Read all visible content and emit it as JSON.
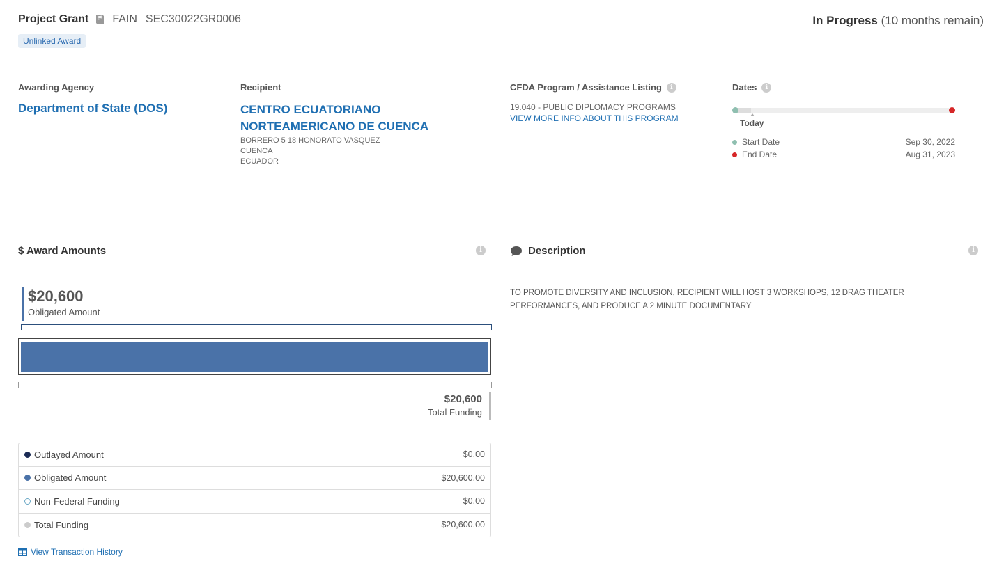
{
  "header": {
    "award_type": "Project Grant",
    "fain_label": "FAIN",
    "fain_value": "SEC30022GR0006",
    "badge": "Unlinked Award",
    "status_bold": "In Progress",
    "status_rest": "(10 months remain)"
  },
  "overview": {
    "agency_label": "Awarding Agency",
    "agency_name": "Department of State (DOS)",
    "recipient_label": "Recipient",
    "recipient_name": "CENTRO ECUATORIANO NORTEAMERICANO DE CUENCA",
    "recipient_address": [
      "BORRERO 5 18 HONORATO VASQUEZ",
      "CUENCA",
      "ECUADOR"
    ],
    "cfda_label": "CFDA Program / Assistance Listing",
    "cfda_program": "19.040 - PUBLIC DIPLOMACY PROGRAMS",
    "cfda_link": "VIEW MORE INFO ABOUT THIS PROGRAM",
    "dates_label": "Dates",
    "today_label": "Today",
    "timeline_progress": 0.07,
    "start_label": "Start Date",
    "start_value": "Sep 30, 2022",
    "end_label": "End Date",
    "end_value": "Aug 31, 2023"
  },
  "amounts": {
    "title": "$ Award Amounts",
    "obligated_amount": "$20,600",
    "obligated_label": "Obligated Amount",
    "total_amount": "$20,600",
    "total_label": "Total Funding",
    "obligated_fraction": 1.0,
    "rows": [
      {
        "label": "Outlayed Amount",
        "value": "$0.00"
      },
      {
        "label": "Obligated Amount",
        "value": "$20,600.00"
      },
      {
        "label": "Non-Federal Funding",
        "value": "$0.00"
      },
      {
        "label": "Total Funding",
        "value": "$20,600.00"
      }
    ],
    "transaction_link": "View Transaction History"
  },
  "description": {
    "title": "Description",
    "text": "TO PROMOTE DIVERSITY AND INCLUSION, RECIPIENT WILL HOST 3 WORKSHOPS, 12 DRAG THEATER PERFORMANCES, AND PRODUCE A 2 MINUTE DOCUMENTARY"
  },
  "colors": {
    "link": "#1f6fb2",
    "obligated": "#4a72a8",
    "outlayed": "#1b2b55",
    "non_federal": "#6aa8c5",
    "total": "#cccccc",
    "start_dot": "#8fbfb0",
    "end_dot": "#d62728"
  }
}
